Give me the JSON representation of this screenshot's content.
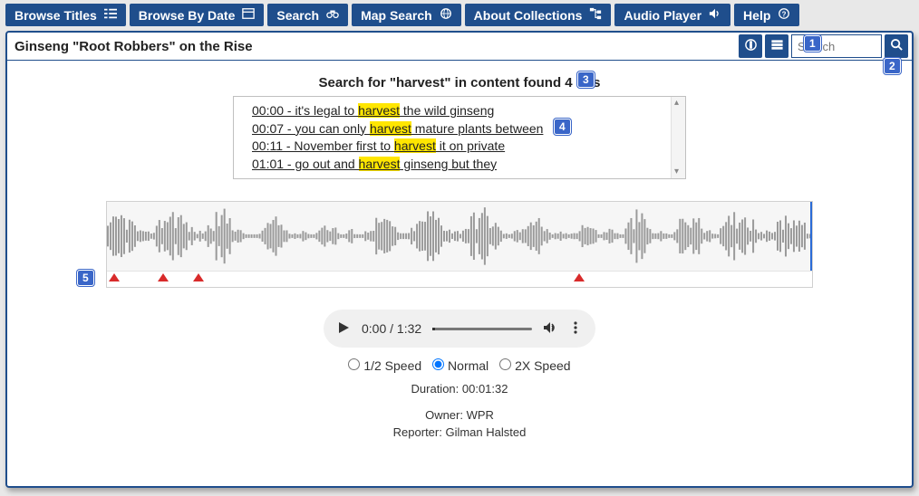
{
  "nav": [
    {
      "label": "Browse Titles",
      "icon": "list"
    },
    {
      "label": "Browse By Date",
      "icon": "calendar"
    },
    {
      "label": "Search",
      "icon": "binoculars"
    },
    {
      "label": "Map Search",
      "icon": "globe"
    },
    {
      "label": "About Collections",
      "icon": "tree"
    },
    {
      "label": "Audio Player",
      "icon": "volume",
      "active": true
    },
    {
      "label": "Help",
      "icon": "help"
    }
  ],
  "title": "Ginseng \"Root Robbers\" on the Rise",
  "search_placeholder": "Search",
  "summary_prefix": "Search for \"",
  "summary_term": "harvest",
  "summary_suffix": "\" in content found 4 hits",
  "hits": [
    {
      "time": "00:00",
      "pre": "it's legal to ",
      "kw": "harvest",
      "post": " the wild ginseng"
    },
    {
      "time": "00:07",
      "pre": "you can only ",
      "kw": "harvest",
      "post": " mature plants between"
    },
    {
      "time": "00:11",
      "pre": "November first to ",
      "kw": "harvest",
      "post": " it on private"
    },
    {
      "time": "01:01",
      "pre": "go out and ",
      "kw": "harvest",
      "post": " ginseng but they"
    }
  ],
  "marker_positions_pct": [
    1,
    8,
    13,
    67
  ],
  "player": {
    "time": "0:00 / 1:32"
  },
  "speed": {
    "half": "1/2 Speed",
    "normal": "Normal",
    "double": "2X Speed",
    "selected": "normal"
  },
  "duration_line": "Duration: 00:01:32",
  "owner_line": "Owner: WPR",
  "reporter_line": "Reporter: Gilman Halsted",
  "badges": {
    "b1": "1",
    "b2": "2",
    "b3": "3",
    "b4": "4",
    "b5": "5"
  }
}
